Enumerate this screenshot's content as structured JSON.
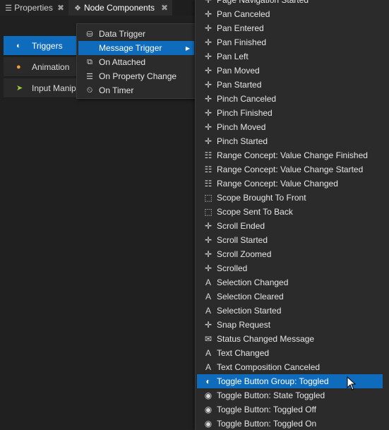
{
  "tabs": [
    {
      "label": "Properties",
      "icon": "list-icon"
    },
    {
      "label": "Node Components",
      "icon": "node-components-icon"
    }
  ],
  "components": [
    {
      "label": "Triggers",
      "icon": "toggle-icon",
      "selected": true
    },
    {
      "label": "Animation",
      "icon": "animation-icon",
      "selected": false
    },
    {
      "label": "Input Manip",
      "icon": "input-icon",
      "selected": false
    }
  ],
  "menu1": [
    {
      "label": "Data Trigger",
      "icon": "database-icon"
    },
    {
      "label": "Message Trigger",
      "icon": "",
      "highlighted": true,
      "submenu": true
    },
    {
      "label": "On Attached",
      "icon": "attached-icon"
    },
    {
      "label": "On Property Change",
      "icon": "property-change-icon"
    },
    {
      "label": "On Timer",
      "icon": "timer-icon"
    }
  ],
  "menu2": [
    {
      "label": "Page Navigation Started",
      "icon": "pan-icon"
    },
    {
      "label": "Pan Canceled",
      "icon": "pan-icon"
    },
    {
      "label": "Pan Entered",
      "icon": "pan-icon"
    },
    {
      "label": "Pan Finished",
      "icon": "pan-icon"
    },
    {
      "label": "Pan Left",
      "icon": "pan-icon"
    },
    {
      "label": "Pan Moved",
      "icon": "pan-icon"
    },
    {
      "label": "Pan Started",
      "icon": "pan-icon"
    },
    {
      "label": "Pinch Canceled",
      "icon": "pan-icon"
    },
    {
      "label": "Pinch Finished",
      "icon": "pan-icon"
    },
    {
      "label": "Pinch Moved",
      "icon": "pan-icon"
    },
    {
      "label": "Pinch Started",
      "icon": "pan-icon"
    },
    {
      "label": "Range Concept: Value Change Finished",
      "icon": "range-icon"
    },
    {
      "label": "Range Concept: Value Change Started",
      "icon": "range-icon"
    },
    {
      "label": "Range Concept: Value Changed",
      "icon": "range-icon"
    },
    {
      "label": "Scope Brought To Front",
      "icon": "scope-icon"
    },
    {
      "label": "Scope Sent To Back",
      "icon": "scope-icon"
    },
    {
      "label": "Scroll Ended",
      "icon": "pan-icon"
    },
    {
      "label": "Scroll Started",
      "icon": "pan-icon"
    },
    {
      "label": "Scroll Zoomed",
      "icon": "pan-icon"
    },
    {
      "label": "Scrolled",
      "icon": "pan-icon"
    },
    {
      "label": "Selection Changed",
      "icon": "text-icon"
    },
    {
      "label": "Selection Cleared",
      "icon": "text-icon"
    },
    {
      "label": "Selection Started",
      "icon": "text-icon"
    },
    {
      "label": "Snap Request",
      "icon": "pan-icon"
    },
    {
      "label": "Status Changed Message",
      "icon": "status-message-icon"
    },
    {
      "label": "Text Changed",
      "icon": "text-icon"
    },
    {
      "label": "Text Composition Canceled",
      "icon": "text-icon"
    },
    {
      "label": "Toggle Button Group: Toggled",
      "icon": "toggle-group-icon",
      "highlighted": true
    },
    {
      "label": "Toggle Button: State Toggled",
      "icon": "toggle-button-icon"
    },
    {
      "label": "Toggle Button: Toggled Off",
      "icon": "toggle-button-icon"
    },
    {
      "label": "Toggle Button: Toggled On",
      "icon": "toggle-button-icon"
    }
  ],
  "colors": {
    "accent": "#0f6cbd",
    "menu_bg": "#2b2b2b",
    "panel_bg": "#202020"
  }
}
